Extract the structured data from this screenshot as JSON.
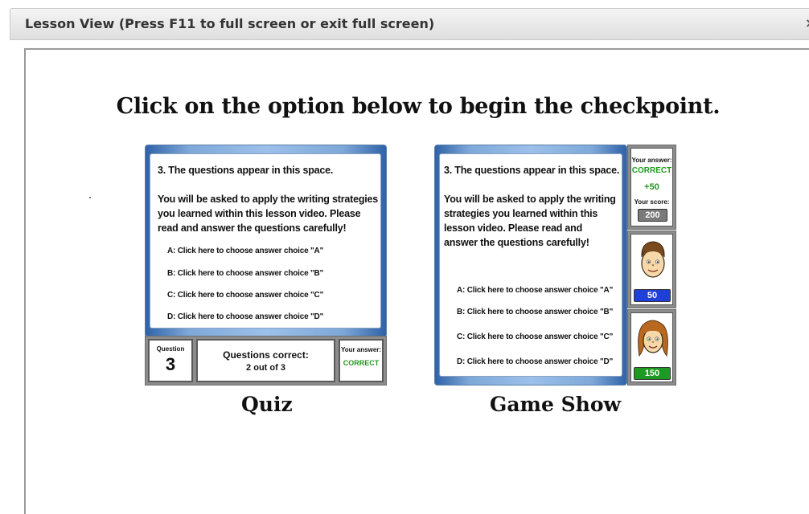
{
  "window": {
    "title": "Lesson View (Press F11 to full screen or exit full screen)",
    "close_glyph": "×"
  },
  "main": {
    "headline": "Click on the option below to begin the checkpoint."
  },
  "quiz": {
    "question": "3. The questions appear in this space.",
    "instructions": "You will be asked to apply the writing strategies you learned within this lesson video. Please read and answer the questions carefully!",
    "options": [
      "A: Click here to choose answer choice \"A\"",
      "B: Click here to choose answer choice \"B\"",
      "C: Click here to choose answer choice \"C\"",
      "D: Click here to choose answer choice \"D\""
    ],
    "question_label": "Question",
    "question_number": "3",
    "correct_label": "Questions correct:",
    "correct_value": "2 out of 3",
    "answer_label": "Your answer:",
    "answer_value": "CORRECT",
    "caption": "Quiz"
  },
  "game_show": {
    "question": "3. The questions appear in this space.",
    "instructions": "You will be asked to apply the writing strategies you learned within this lesson video. Please read and answer the questions carefully!",
    "options": [
      "A: Click here to choose answer choice \"A\"",
      "B: Click here to choose answer choice \"B\"",
      "C: Click here to choose answer choice \"C\"",
      "D: Click here to choose answer choice \"D\""
    ],
    "answer_label": "Your answer:",
    "answer_value": "CORRECT",
    "points": "+50",
    "score_label": "Your score:",
    "score_value": "200",
    "player1_score": "50",
    "player2_score": "150",
    "caption": "Game Show"
  },
  "colors": {
    "correct_green": "#1f9a1f",
    "player1_blue": "#1f3fd8",
    "player2_green": "#1e9a22",
    "score_gray": "#7a7a7a"
  }
}
